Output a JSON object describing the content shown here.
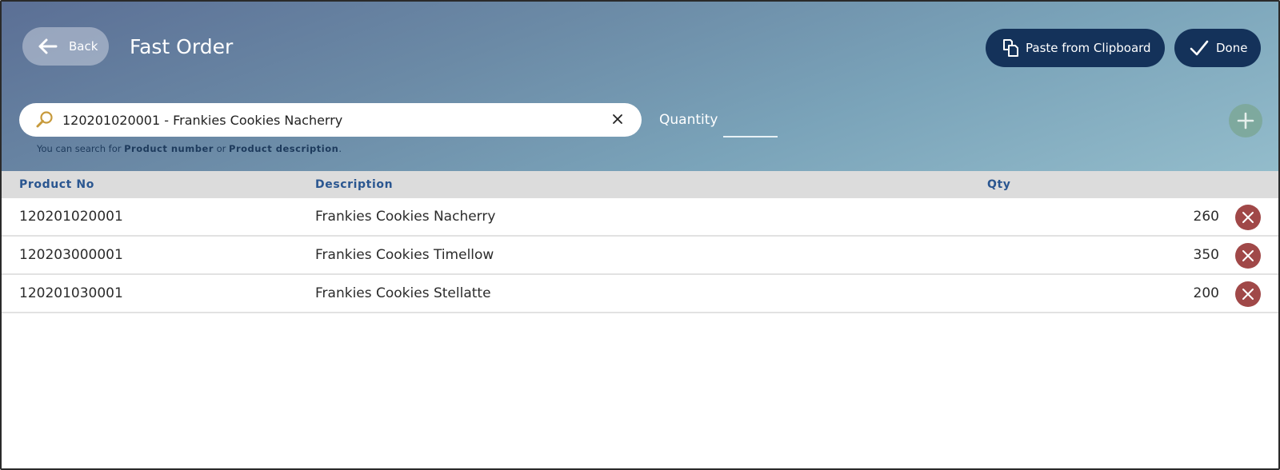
{
  "header": {
    "back_label": "Back",
    "title": "Fast Order",
    "paste_label": "Paste from Clipboard",
    "done_label": "Done"
  },
  "search": {
    "value": "120201020001 - Frankies Cookies Nacherry",
    "hint_prefix": "You can search for ",
    "hint_term1": "Product number",
    "hint_mid": " or ",
    "hint_term2": "Product description",
    "hint_suffix": "."
  },
  "quantity": {
    "label": "Quantity",
    "value": ""
  },
  "table": {
    "columns": {
      "product_no": "Product No",
      "description": "Description",
      "qty": "Qty"
    },
    "rows": [
      {
        "product_no": "120201020001",
        "description": "Frankies Cookies Nacherry",
        "qty": "260"
      },
      {
        "product_no": "120203000001",
        "description": "Frankies Cookies Timellow",
        "qty": "350"
      },
      {
        "product_no": "120201030001",
        "description": "Frankies Cookies Stellatte",
        "qty": "200"
      }
    ]
  },
  "colors": {
    "primary_button": "#14325a",
    "header_link": "#2a5690",
    "delete": "#a04848",
    "add": "#7ea99e",
    "search_icon": "#c79a3c"
  }
}
